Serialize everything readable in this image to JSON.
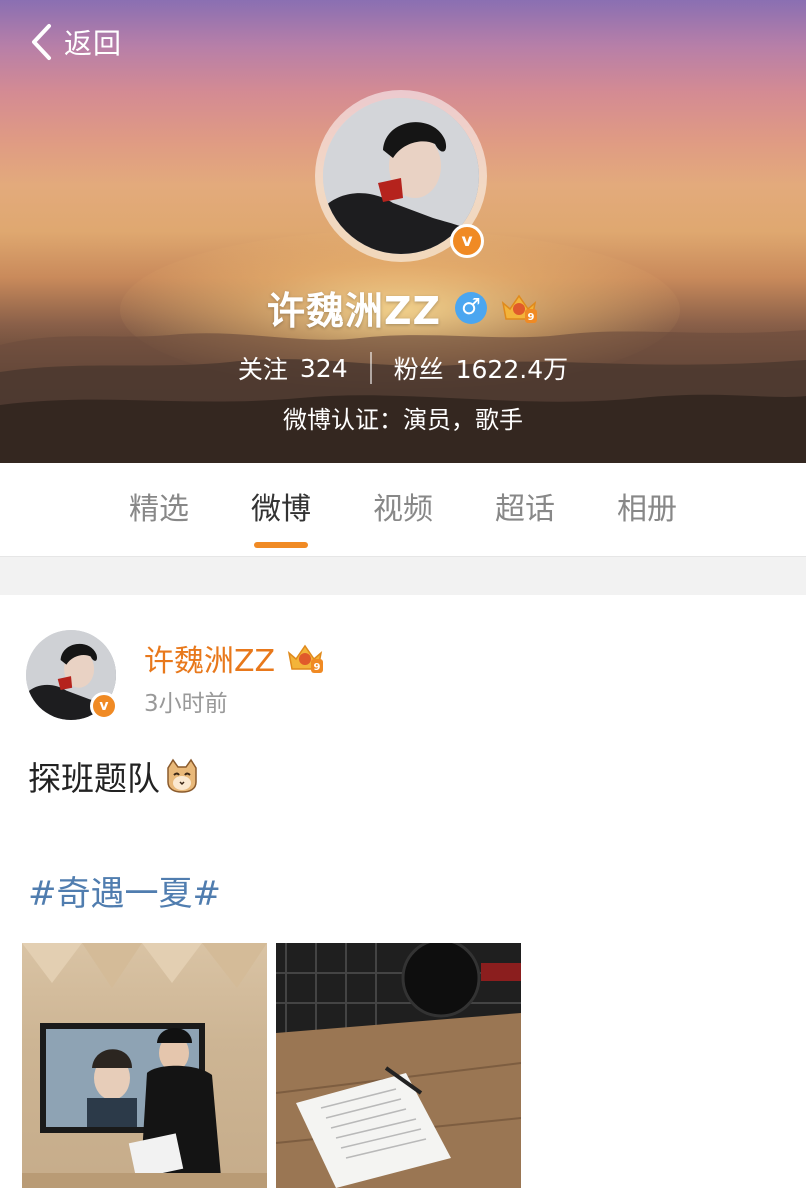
{
  "nav": {
    "back_label": "返回",
    "back_icon": "chevron-left-icon"
  },
  "profile": {
    "name": "许魏洲ZZ",
    "gender_symbol": "♂",
    "following_label": "关注",
    "following_count": "324",
    "followers_label": "粉丝",
    "followers_count": "1622.4万",
    "verification": "微博认证：演员，歌手",
    "verified_badge": "v",
    "badge_level": "9"
  },
  "tabs": [
    {
      "label": "精选",
      "active": false
    },
    {
      "label": "微博",
      "active": true
    },
    {
      "label": "视频",
      "active": false
    },
    {
      "label": "超话",
      "active": false
    },
    {
      "label": "相册",
      "active": false
    }
  ],
  "post": {
    "author": "许魏洲ZZ",
    "time": "3小时前",
    "text": "探班题队",
    "emoji_icon": "cat-face-icon",
    "topic": "#奇遇一夏#",
    "photos": [
      {
        "name": "photo-studio-portrait"
      },
      {
        "name": "photo-script-desk"
      }
    ]
  },
  "colors": {
    "accent_orange": "#f08a24",
    "author_orange": "#e8781b",
    "topic_blue": "#507daf",
    "gender_blue": "#4ba6f0"
  }
}
